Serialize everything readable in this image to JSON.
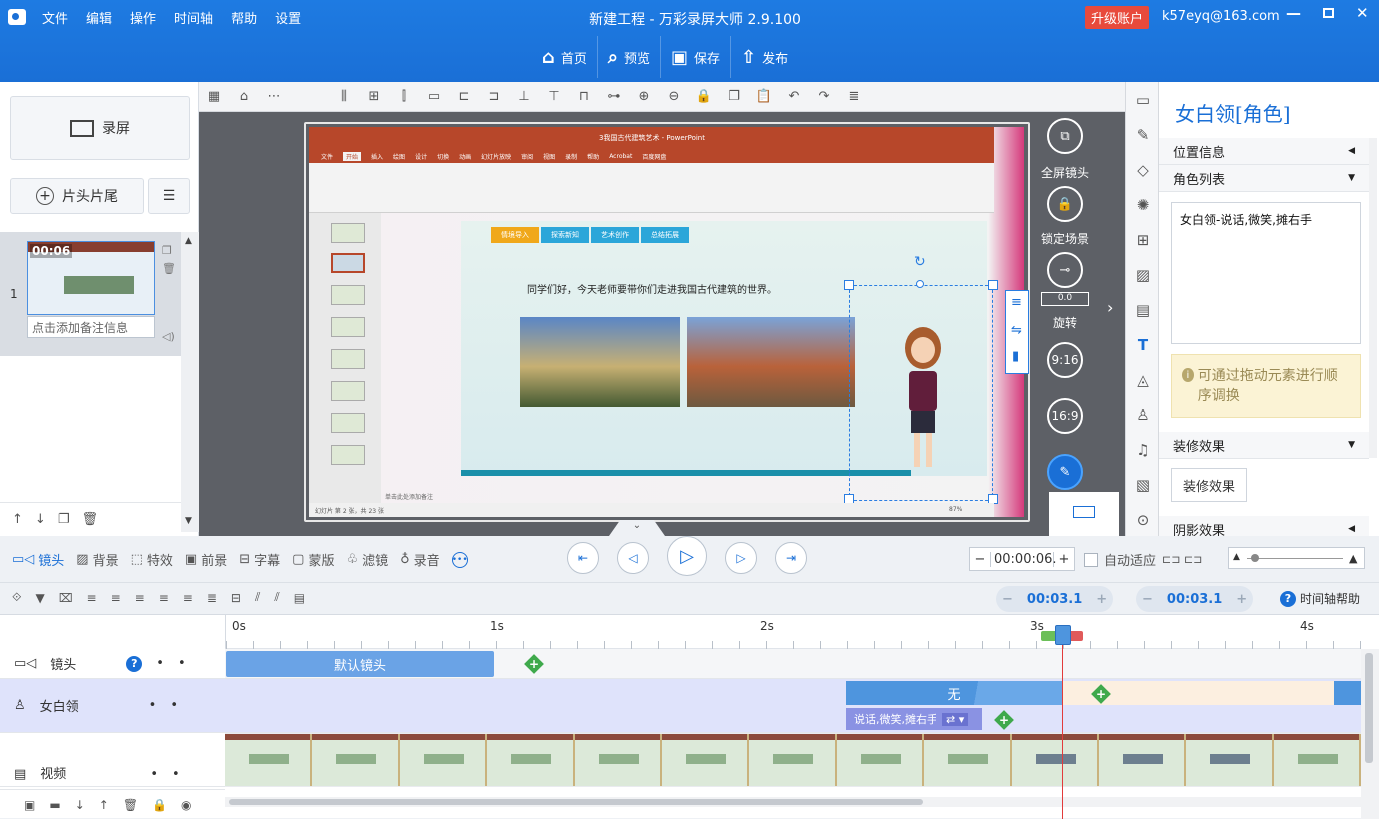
{
  "titlebar": {
    "menu": [
      "文件",
      "编辑",
      "操作",
      "时间轴",
      "帮助",
      "设置"
    ],
    "title": "新建工程 - 万彩录屏大师 2.9.100",
    "upgrade": "升级账户",
    "user": "k57eyq@163.com",
    "nav": [
      {
        "icon": "home-icon",
        "label": "首页"
      },
      {
        "icon": "preview-icon",
        "label": "预览"
      },
      {
        "icon": "save-icon",
        "label": "保存"
      },
      {
        "icon": "publish-icon",
        "label": "发布"
      }
    ]
  },
  "left": {
    "record_label": "录屏",
    "intro_outro": "片头片尾",
    "scene": {
      "time": "00:06",
      "number": "1",
      "note": "点击添加备注信息"
    }
  },
  "canvas": {
    "side_buttons": [
      {
        "label": "全屏镜头"
      },
      {
        "label": "锁定场景"
      },
      {
        "label": "旋转",
        "value": "0.0"
      },
      {
        "label": "9:16"
      },
      {
        "label": "16:9"
      }
    ],
    "slide_title_bar": "3我国古代建筑艺术 - PowerPoint",
    "ribbon_tabs": [
      "文件",
      "开始",
      "插入",
      "绘图",
      "设计",
      "切换",
      "动画",
      "幻灯片放映",
      "审阅",
      "视图",
      "录制",
      "帮助",
      "Acrobat",
      "百度网盘"
    ],
    "slide_tabs": [
      "情境导入",
      "探索新知",
      "艺术创作",
      "总结拓展"
    ],
    "slide_text": "同学们好，今天老师要带你们走进我国古代建筑的世界。",
    "status": "幻灯片 第 2 张，共 23 张",
    "notes_hint": "单击此处添加备注",
    "zoom": "87%"
  },
  "right": {
    "heading": "女白领[角色]",
    "position": "位置信息",
    "role_list": "角色列表",
    "role_actions": "女白领-说话,微笑,摊右手",
    "tip": "可通过拖动元素进行顺序调换",
    "deco_title": "装修效果",
    "deco_button": "装修效果",
    "shadow": "阴影效果"
  },
  "tabs": [
    {
      "label": "镜头",
      "icon": "camera-icon"
    },
    {
      "label": "背景",
      "icon": "background-icon"
    },
    {
      "label": "特效",
      "icon": "effects-icon"
    },
    {
      "label": "前景",
      "icon": "foreground-icon"
    },
    {
      "label": "字幕",
      "icon": "subtitle-icon"
    },
    {
      "label": "蒙版",
      "icon": "mask-icon"
    },
    {
      "label": "滤镜",
      "icon": "filter-icon"
    },
    {
      "label": "录音",
      "icon": "mic-icon"
    }
  ],
  "timecode": "00:00:06.",
  "auto_fit": "自动适应",
  "tl_times": [
    "00:03.1",
    "00:03.1"
  ],
  "tl_help": "时间轴帮助",
  "ruler": [
    "0s",
    "1s",
    "2s",
    "3s",
    "4s"
  ],
  "tracks": [
    {
      "name": "镜头",
      "icon": "camera-icon",
      "clip": "默认镜头"
    },
    {
      "name": "女白领",
      "icon": "person-icon",
      "clip": "无",
      "action": "说话,微笑,摊右手"
    },
    {
      "name": "视频",
      "icon": "video-icon"
    }
  ]
}
